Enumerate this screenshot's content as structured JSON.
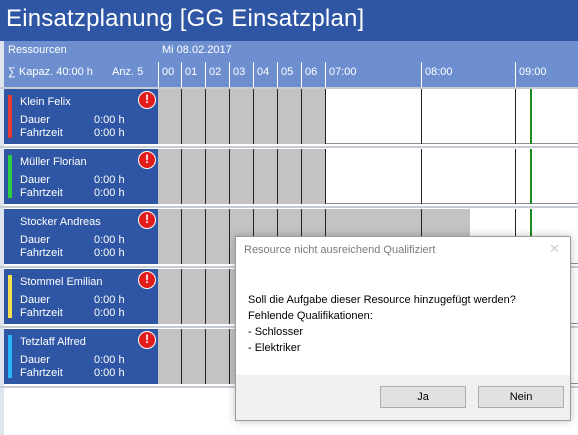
{
  "window": {
    "title": "Einsatzplanung [GG Einsatzplan]"
  },
  "header": {
    "resources_label": "Ressourcen",
    "capacity": "∑ Kapaz. 40:00 h",
    "count": "Anz. 5",
    "date": "Mi 08.02.2017",
    "hours": [
      "00",
      "01",
      "02",
      "03",
      "04",
      "05",
      "06",
      "07:00",
      "08:00",
      "09:00"
    ]
  },
  "resources": [
    {
      "name": "Klein Felix",
      "color": "#e53935",
      "dauer_label": "Dauer",
      "dauer": "0:00 h",
      "fahrtzeit_label": "Fahrtzeit",
      "fahrtzeit": "0:00 h",
      "warning": "!"
    },
    {
      "name": "Müller Florian",
      "color": "#2ecc40",
      "dauer_label": "Dauer",
      "dauer": "0:00 h",
      "fahrtzeit_label": "Fahrtzeit",
      "fahrtzeit": "0:00 h",
      "warning": "!"
    },
    {
      "name": "Stocker Andreas",
      "color": "#2e56a4",
      "dauer_label": "Dauer",
      "dauer": "0:00 h",
      "fahrtzeit_label": "Fahrtzeit",
      "fahrtzeit": "0:00 h",
      "warning": "!"
    },
    {
      "name": "Stommel Emilian",
      "color": "#f4e04d",
      "dauer_label": "Dauer",
      "dauer": "0:00 h",
      "fahrtzeit_label": "Fahrtzeit",
      "fahrtzeit": "0:00 h",
      "warning": "!"
    },
    {
      "name": "Tetzlaff Alfred",
      "color": "#29b6f6",
      "dauer_label": "Dauer",
      "dauer": "0:00 h",
      "fahrtzeit_label": "Fahrtzeit",
      "fahrtzeit": "0:00 h",
      "warning": "!"
    }
  ],
  "dialog": {
    "title": "Resource nicht ausreichend Qualifiziert",
    "close": "✕",
    "question": "Soll die Aufgabe dieser Resource hinzugefügt werden?",
    "missing_label": "Fehlende Qualifikationen:",
    "qualifications": [
      "- Schlosser",
      "- Elektriker"
    ],
    "yes_label": "Ja",
    "no_label": "Nein"
  },
  "colors": {
    "header_bg": "#2e56a4",
    "subheader_bg": "#6d8fcf",
    "blocked": "#c3c3c3",
    "now_line": "#1d8a1d",
    "warning": "#e21b1b"
  }
}
